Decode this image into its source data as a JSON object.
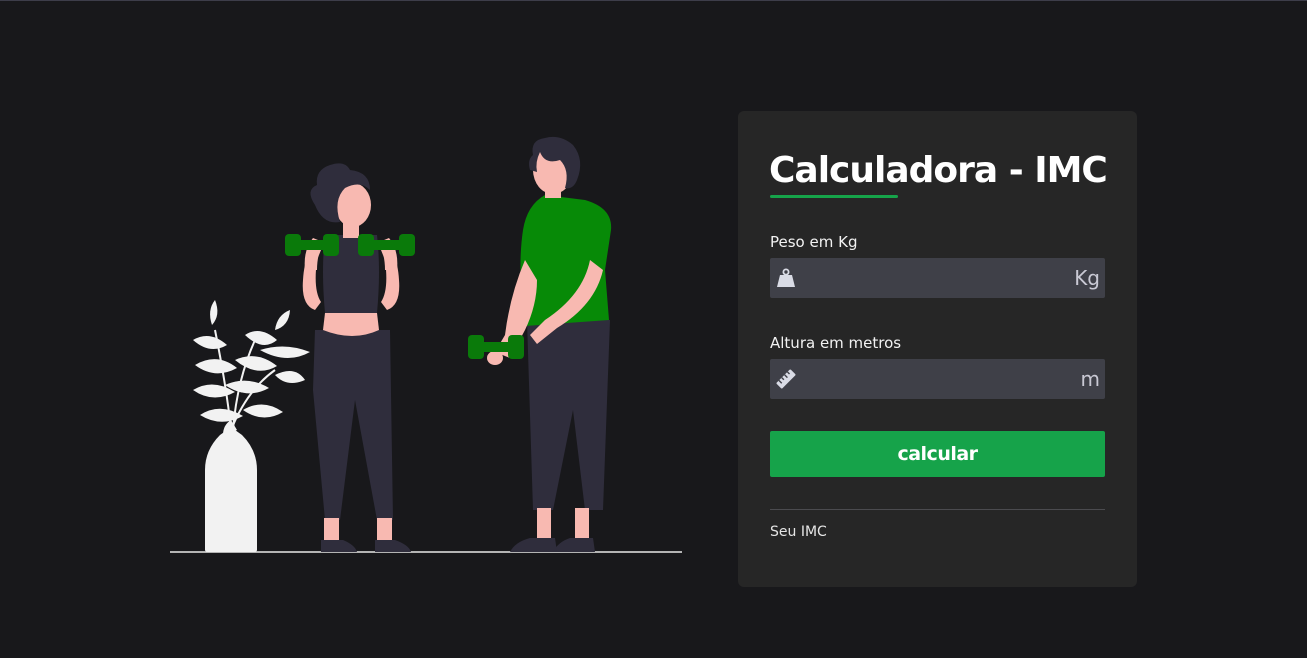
{
  "illustration": {
    "description_icon": "fitness-people-icon",
    "colors": {
      "dumbbell": "#0a7a0a",
      "shirt": "#078a07",
      "skin": "#f8b9b1",
      "clothes": "#2f2d3c",
      "hair": "#2f2d3c",
      "plant": "#f2f2f2"
    }
  },
  "card": {
    "title": "Calculadora - IMC",
    "peso": {
      "label": "Peso em Kg",
      "icon": "weight-icon",
      "value": "",
      "unit": "Kg"
    },
    "altura": {
      "label": "Altura em metros",
      "icon": "ruler-icon",
      "value": "",
      "unit": "m"
    },
    "button_label": "calcular",
    "result_label": "Seu IMC"
  },
  "colors": {
    "background": "#18181b",
    "card": "#262626",
    "accent": "#16a34a",
    "input": "#3f4048"
  }
}
